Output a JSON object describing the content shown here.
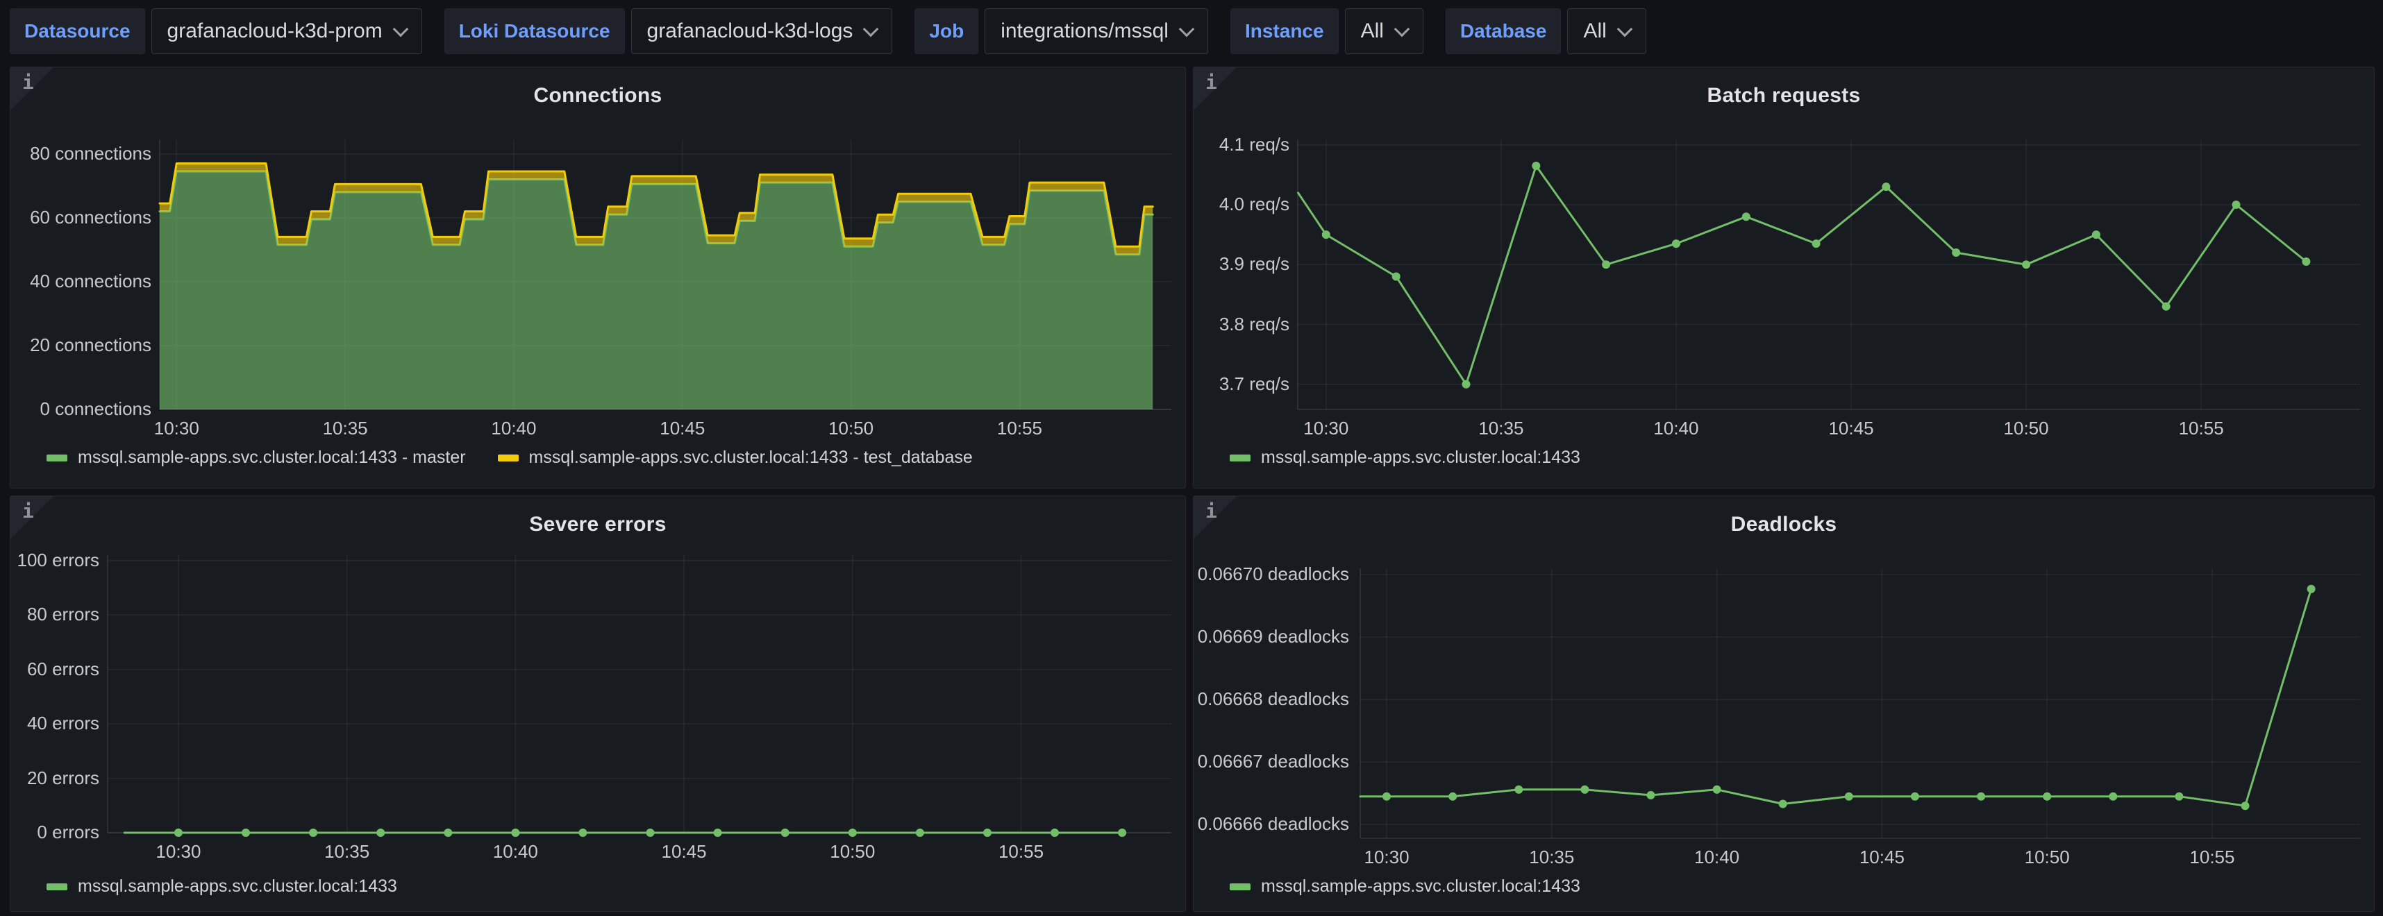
{
  "ui": {
    "info_glyph": "i"
  },
  "colors": {
    "page_bg": "#111217",
    "panel_bg": "#181b20",
    "accent_blue": "#6e9fff",
    "series_green": "#73bf69",
    "series_yellow": "#f2cc0c"
  },
  "toolbar": {
    "filters": [
      {
        "label": "Datasource",
        "value": "grafanacloud-k3d-prom"
      },
      {
        "label": "Loki Datasource",
        "value": "grafanacloud-k3d-logs"
      },
      {
        "label": "Job",
        "value": "integrations/mssql"
      },
      {
        "label": "Instance",
        "value": "All"
      },
      {
        "label": "Database",
        "value": "All"
      }
    ]
  },
  "panels": [
    {
      "title": "Connections",
      "legend": [
        {
          "label": "mssql.sample-apps.svc.cluster.local:1433 - master",
          "color": "#73bf69"
        },
        {
          "label": "mssql.sample-apps.svc.cluster.local:1433 - test_database",
          "color": "#f2cc0c"
        }
      ]
    },
    {
      "title": "Batch requests",
      "legend": [
        {
          "label": "mssql.sample-apps.svc.cluster.local:1433",
          "color": "#73bf69"
        }
      ]
    },
    {
      "title": "Severe errors",
      "legend": [
        {
          "label": "mssql.sample-apps.svc.cluster.local:1433",
          "color": "#73bf69"
        }
      ]
    },
    {
      "title": "Deadlocks",
      "legend": [
        {
          "label": "mssql.sample-apps.svc.cluster.local:1433",
          "color": "#73bf69"
        }
      ]
    }
  ],
  "chart_data": [
    {
      "type": "area",
      "title": "Connections",
      "ylabel": "connections",
      "grid": true,
      "legend_position": "bottom",
      "stacked": true,
      "x_domain": [
        29.5,
        59.5
      ],
      "y_domain": [
        0,
        84.5
      ],
      "x_ticks": [
        {
          "t": 30,
          "label": "10:30"
        },
        {
          "t": 35,
          "label": "10:35"
        },
        {
          "t": 40,
          "label": "10:40"
        },
        {
          "t": 45,
          "label": "10:45"
        },
        {
          "t": 50,
          "label": "10:50"
        },
        {
          "t": 55,
          "label": "10:55"
        }
      ],
      "y_ticks": [
        {
          "v": 80,
          "label": "80 connections"
        },
        {
          "v": 60,
          "label": "60 connections"
        },
        {
          "v": 40,
          "label": "40 connections"
        },
        {
          "v": 20,
          "label": "20 connections"
        },
        {
          "v": 0,
          "label": "0 connections"
        }
      ],
      "series": [
        {
          "name": "mssql.sample-apps.svc.cluster.local:1433 - master",
          "color": "#73bf69",
          "fill_opacity": 0.62,
          "markers": false,
          "points": [
            [
              29.5,
              62
            ],
            [
              29.8,
              62
            ],
            [
              30.0,
              74.5
            ],
            [
              32.65,
              74.5
            ],
            [
              33.0,
              51.5
            ],
            [
              33.85,
              51.5
            ],
            [
              34.0,
              59.5
            ],
            [
              34.55,
              59.5
            ],
            [
              34.7,
              68
            ],
            [
              37.25,
              68
            ],
            [
              37.6,
              51.5
            ],
            [
              38.4,
              51.5
            ],
            [
              38.55,
              59.5
            ],
            [
              39.1,
              59.5
            ],
            [
              39.25,
              72
            ],
            [
              41.5,
              72
            ],
            [
              41.85,
              51.5
            ],
            [
              42.65,
              51.5
            ],
            [
              42.8,
              61
            ],
            [
              43.35,
              61
            ],
            [
              43.5,
              70.5
            ],
            [
              45.4,
              70.5
            ],
            [
              45.75,
              52
            ],
            [
              46.55,
              52
            ],
            [
              46.7,
              59
            ],
            [
              47.15,
              59
            ],
            [
              47.3,
              71
            ],
            [
              49.45,
              71
            ],
            [
              49.8,
              51
            ],
            [
              50.65,
              51
            ],
            [
              50.8,
              58.5
            ],
            [
              51.25,
              58.5
            ],
            [
              51.4,
              65
            ],
            [
              53.55,
              65
            ],
            [
              53.9,
              51.5
            ],
            [
              54.55,
              51.5
            ],
            [
              54.7,
              58
            ],
            [
              55.15,
              58
            ],
            [
              55.3,
              68.5
            ],
            [
              57.5,
              68.5
            ],
            [
              57.85,
              48.5
            ],
            [
              58.55,
              48.5
            ],
            [
              58.7,
              61
            ],
            [
              58.95,
              61
            ]
          ]
        },
        {
          "name": "mssql.sample-apps.svc.cluster.local:1433 - test_database",
          "color": "#f2cc0c",
          "fill_opacity": 0.62,
          "markers": false,
          "stack_on_previous": true,
          "constant_value": 2.5
        }
      ]
    },
    {
      "type": "line",
      "title": "Batch requests",
      "ylabel": "req/s",
      "grid": true,
      "legend_position": "bottom",
      "x_domain": [
        29.19,
        59.54
      ],
      "y_domain": [
        3.658,
        4.109
      ],
      "x_ticks": [
        {
          "t": 30,
          "label": "10:30"
        },
        {
          "t": 35,
          "label": "10:35"
        },
        {
          "t": 40,
          "label": "10:40"
        },
        {
          "t": 45,
          "label": "10:45"
        },
        {
          "t": 50,
          "label": "10:50"
        },
        {
          "t": 55,
          "label": "10:55"
        }
      ],
      "y_ticks": [
        {
          "v": 4.1,
          "label": "4.1 req/s"
        },
        {
          "v": 4.0,
          "label": "4.0 req/s"
        },
        {
          "v": 3.9,
          "label": "3.9 req/s"
        },
        {
          "v": 3.8,
          "label": "3.8 req/s"
        },
        {
          "v": 3.7,
          "label": "3.7 req/s"
        }
      ],
      "series": [
        {
          "name": "mssql.sample-apps.svc.cluster.local:1433",
          "color": "#73bf69",
          "markers": true,
          "edge_start": true,
          "points": [
            [
              29.2,
              4.02
            ],
            [
              30,
              3.95
            ],
            [
              32,
              3.88
            ],
            [
              34,
              3.7
            ],
            [
              36,
              4.065
            ],
            [
              38,
              3.9
            ],
            [
              40,
              3.935
            ],
            [
              42,
              3.98
            ],
            [
              44,
              3.935
            ],
            [
              46,
              4.03
            ],
            [
              48,
              3.92
            ],
            [
              50,
              3.9
            ],
            [
              52,
              3.95
            ],
            [
              54,
              3.83
            ],
            [
              56,
              4.0
            ],
            [
              58,
              3.905
            ]
          ]
        }
      ]
    },
    {
      "type": "line",
      "title": "Severe errors",
      "ylabel": "errors",
      "grid": true,
      "legend_position": "bottom",
      "x_domain": [
        27.9,
        59.46
      ],
      "y_domain": [
        0,
        102
      ],
      "x_ticks": [
        {
          "t": 30,
          "label": "10:30"
        },
        {
          "t": 35,
          "label": "10:35"
        },
        {
          "t": 40,
          "label": "10:40"
        },
        {
          "t": 45,
          "label": "10:45"
        },
        {
          "t": 50,
          "label": "10:50"
        },
        {
          "t": 55,
          "label": "10:55"
        }
      ],
      "y_ticks": [
        {
          "v": 100,
          "label": "100 errors"
        },
        {
          "v": 80,
          "label": "80 errors"
        },
        {
          "v": 60,
          "label": "60 errors"
        },
        {
          "v": 40,
          "label": "40 errors"
        },
        {
          "v": 20,
          "label": "20 errors"
        },
        {
          "v": 0,
          "label": "0 errors"
        }
      ],
      "series": [
        {
          "name": "mssql.sample-apps.svc.cluster.local:1433",
          "color": "#73bf69",
          "markers": true,
          "edge_start": true,
          "points": [
            [
              28.4,
              0
            ],
            [
              30,
              0
            ],
            [
              32,
              0
            ],
            [
              34,
              0
            ],
            [
              36,
              0
            ],
            [
              38,
              0
            ],
            [
              40,
              0
            ],
            [
              42,
              0
            ],
            [
              44,
              0
            ],
            [
              46,
              0
            ],
            [
              48,
              0
            ],
            [
              50,
              0
            ],
            [
              52,
              0
            ],
            [
              54,
              0
            ],
            [
              56,
              0
            ],
            [
              58,
              0
            ]
          ]
        }
      ]
    },
    {
      "type": "line",
      "title": "Deadlocks",
      "ylabel": "deadlocks",
      "grid": true,
      "legend_position": "bottom",
      "x_domain": [
        29.2,
        59.48
      ],
      "y_domain": [
        0.0666578,
        0.066701
      ],
      "x_ticks": [
        {
          "t": 30,
          "label": "10:30"
        },
        {
          "t": 35,
          "label": "10:35"
        },
        {
          "t": 40,
          "label": "10:40"
        },
        {
          "t": 45,
          "label": "10:45"
        },
        {
          "t": 50,
          "label": "10:50"
        },
        {
          "t": 55,
          "label": "10:55"
        }
      ],
      "y_ticks": [
        {
          "v": 0.0667,
          "label": "0.06670 deadlocks"
        },
        {
          "v": 0.06669,
          "label": "0.06669 deadlocks"
        },
        {
          "v": 0.06668,
          "label": "0.06668 deadlocks"
        },
        {
          "v": 0.06667,
          "label": "0.06667 deadlocks"
        },
        {
          "v": 0.06666,
          "label": "0.06666 deadlocks"
        }
      ],
      "series": [
        {
          "name": "mssql.sample-apps.svc.cluster.local:1433",
          "color": "#73bf69",
          "markers": true,
          "edge_start": true,
          "points": [
            [
              29.2,
              0.0666645
            ],
            [
              30,
              0.0666645
            ],
            [
              32,
              0.0666645
            ],
            [
              34,
              0.0666656
            ],
            [
              36,
              0.0666656
            ],
            [
              38,
              0.0666647
            ],
            [
              40,
              0.0666656
            ],
            [
              42,
              0.0666633
            ],
            [
              44,
              0.0666645
            ],
            [
              46,
              0.0666645
            ],
            [
              48,
              0.0666645
            ],
            [
              50,
              0.0666645
            ],
            [
              52,
              0.0666645
            ],
            [
              54,
              0.0666645
            ],
            [
              56,
              0.066663
            ],
            [
              58,
              0.0666977
            ]
          ]
        }
      ]
    }
  ]
}
